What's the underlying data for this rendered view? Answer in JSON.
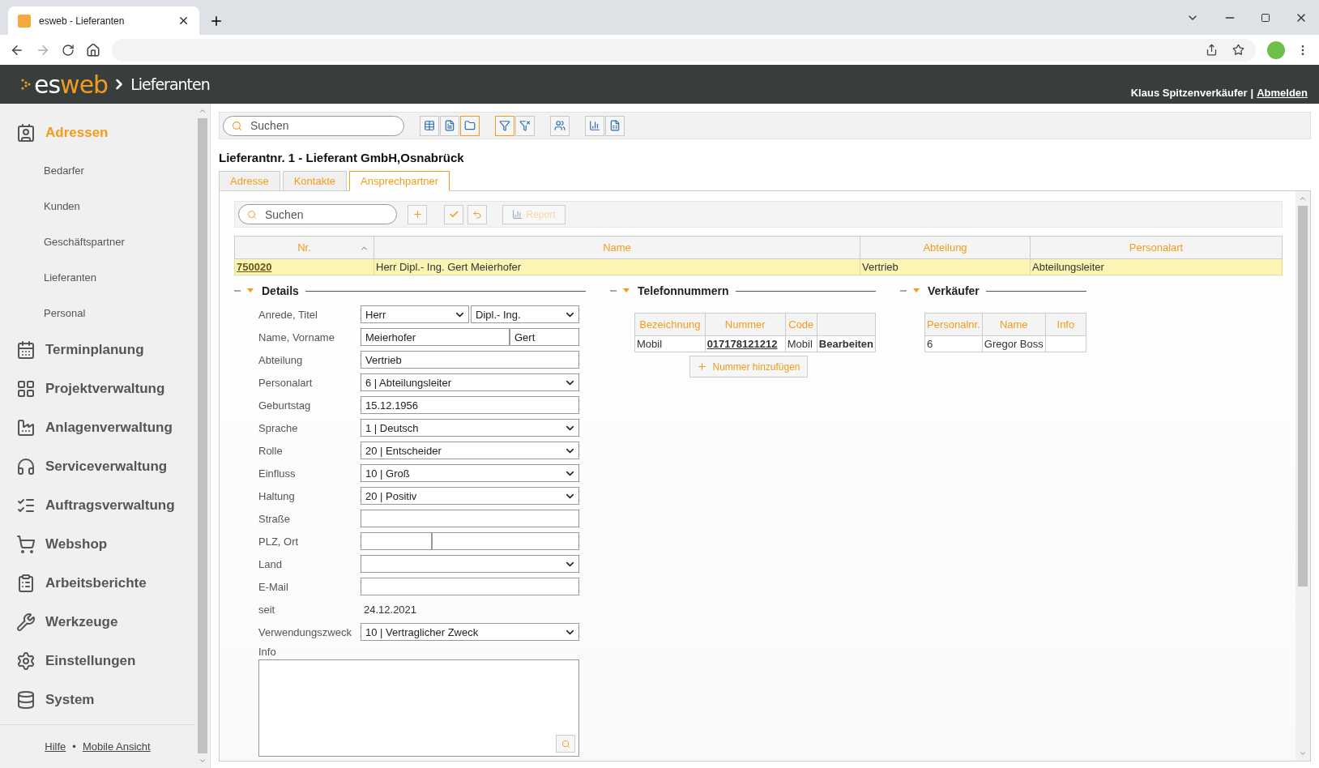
{
  "browser": {
    "tab_title": "esweb - Lieferanten"
  },
  "header": {
    "logo_prefix": "es",
    "logo_suffix": "web",
    "breadcrumb": "Lieferanten",
    "user": "Klaus Spitzenverkäufer",
    "separator": "|",
    "logout": "Abmelden"
  },
  "sidebar": {
    "items": [
      {
        "label": "Adressen",
        "kind": "adressen",
        "selected": true,
        "children": [
          {
            "label": "Bedarfer",
            "selected": false
          },
          {
            "label": "Kunden",
            "selected": false
          },
          {
            "label": "Geschäftspartner",
            "selected": false
          },
          {
            "label": "Lieferanten",
            "selected": false
          },
          {
            "label": "Personal",
            "selected": false
          }
        ]
      },
      {
        "label": "Terminplanung",
        "kind": "calendar",
        "selected": false
      },
      {
        "label": "Projektverwaltung",
        "kind": "project",
        "selected": false
      },
      {
        "label": "Anlagenverwaltung",
        "kind": "factory",
        "selected": false
      },
      {
        "label": "Serviceverwaltung",
        "kind": "headset",
        "selected": false
      },
      {
        "label": "Auftragsverwaltung",
        "kind": "list",
        "selected": false
      },
      {
        "label": "Webshop",
        "kind": "cart",
        "selected": false
      },
      {
        "label": "Arbeitsberichte",
        "kind": "clipboard",
        "selected": false
      },
      {
        "label": "Werkzeuge",
        "kind": "tools",
        "selected": false
      },
      {
        "label": "Einstellungen",
        "kind": "gears",
        "selected": false
      },
      {
        "label": "System",
        "kind": "database",
        "selected": false
      }
    ],
    "footer": [
      "Hilfe",
      "•",
      "Mobile Ansicht"
    ]
  },
  "toolbar": {
    "search_placeholder": "Suchen",
    "groups": [
      [
        {
          "kind": "grid",
          "selected": false
        },
        {
          "kind": "detail",
          "selected": false
        },
        {
          "kind": "folder",
          "selected": true
        }
      ],
      [
        {
          "kind": "filter",
          "selected": true
        },
        {
          "kind": "filter-off",
          "selected": false
        }
      ],
      [
        {
          "kind": "people",
          "selected": false
        }
      ],
      [
        {
          "kind": "report",
          "selected": false
        },
        {
          "kind": "excel",
          "selected": false
        }
      ]
    ]
  },
  "title": "Lieferantnr. 1 - Lieferant GmbH,Osnabrück",
  "tabs": [
    {
      "label": "Adresse",
      "selected": false
    },
    {
      "label": "Kontakte",
      "selected": false
    },
    {
      "label": "Ansprechpartner",
      "selected": true
    }
  ],
  "subtoolbar": {
    "search_placeholder": "Suchen",
    "report": {
      "label": "Report",
      "disabled": true
    }
  },
  "table": {
    "columns": [
      "Nr.",
      "Name",
      "Abteilung",
      "Personalart"
    ],
    "rows": [
      {
        "cells": [
          "750020",
          "Herr Dipl.- Ing. Gert Meierhofer",
          "Vertrieb",
          "Abteilungsleiter"
        ],
        "selected": true
      }
    ]
  },
  "details": {
    "title": "Details",
    "fields": [
      {
        "label": "Anrede, Titel",
        "kind": "select2",
        "value": "Herr",
        "value2": "Dipl.- Ing."
      },
      {
        "label": "Name, Vorname",
        "kind": "text2",
        "value": "Meierhofer",
        "value2": "Gert"
      },
      {
        "label": "Abteilung",
        "kind": "text",
        "value": "Vertrieb"
      },
      {
        "label": "Personalart",
        "kind": "select",
        "value": "6 | Abteilungsleiter"
      },
      {
        "label": "Geburtstag",
        "kind": "text",
        "value": "15.12.1956"
      },
      {
        "label": "Sprache",
        "kind": "select",
        "value": "1 | Deutsch"
      },
      {
        "label": "Rolle",
        "kind": "select",
        "value": "20 | Entscheider"
      },
      {
        "label": "Einfluss",
        "kind": "select",
        "value": "10 | Groß"
      },
      {
        "label": "Haltung",
        "kind": "select",
        "value": "20 | Positiv"
      },
      {
        "label": "Straße",
        "kind": "text"
      },
      {
        "label": "PLZ, Ort",
        "kind": "plz"
      },
      {
        "label": "Land",
        "kind": "select"
      },
      {
        "label": "E-Mail",
        "kind": "text"
      },
      {
        "label": "seit",
        "kind": "static",
        "value": "24.12.2021"
      },
      {
        "label": "Verwendungszweck",
        "kind": "select",
        "value": "10 | Vertraglicher Zweck"
      },
      {
        "label": "Info",
        "kind": "textarea"
      }
    ]
  },
  "phones": {
    "title": "Telefonnummern",
    "columns": [
      "Bezeichnung",
      "Nummer",
      "Code"
    ],
    "rows": [
      {
        "label": "Mobil",
        "number": "017178121212",
        "code": "Mobil",
        "action": "Bearbeiten"
      }
    ],
    "add_button": "Nummer hinzufügen"
  },
  "sellers": {
    "title": "Verkäufer",
    "columns": [
      "Personalnr.",
      "Name",
      "Info"
    ],
    "rows": [
      {
        "number": "6",
        "name": "Gregor Boss"
      }
    ]
  }
}
